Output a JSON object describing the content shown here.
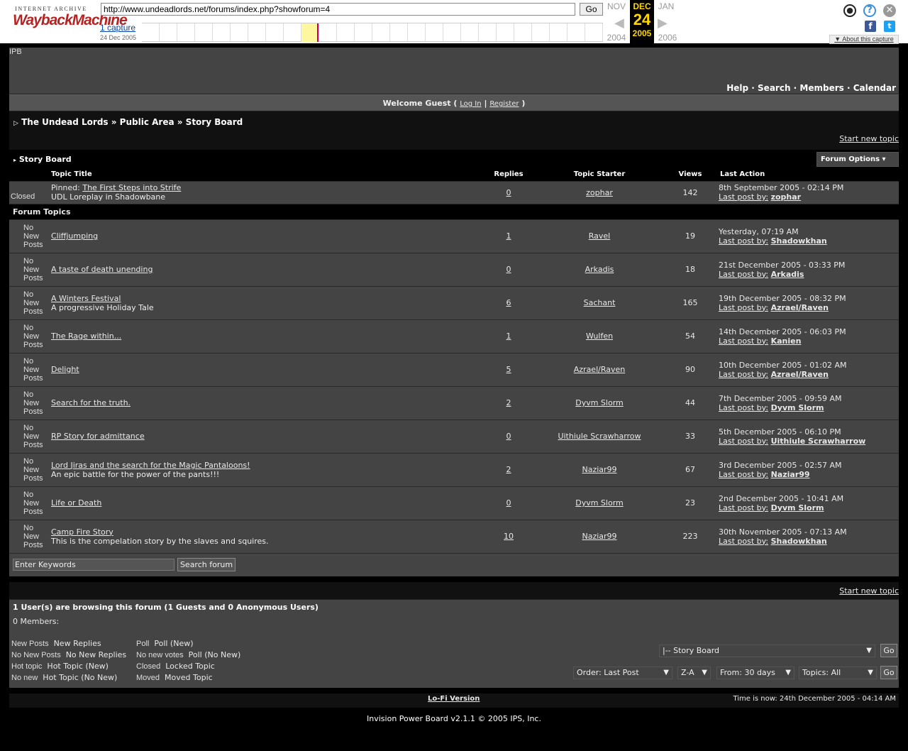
{
  "wayback": {
    "ia_label": "INTERNET ARCHIVE",
    "brand": "WaybackMachine",
    "url": "http://www.undeadlords.net/forums/index.php?showforum=4",
    "go": "Go",
    "captures": "1 capture",
    "capture_date": "24 Dec 2005",
    "prev_month": "NOV",
    "cur_month": "DEC",
    "next_month": "JAN",
    "cur_day": "24",
    "prev_year": "2004",
    "cur_year": "2005",
    "next_year": "2006",
    "about": "About this capture"
  },
  "board": {
    "logo_alt": "IPB",
    "nav": "Help · Search · Members · Calendar",
    "welcome_prefix": "Welcome Guest (",
    "login": "Log In",
    "sep": "|",
    "register": "Register",
    "welcome_suffix": ")",
    "breadcrumb": "The Undead Lords » Public Area » Story Board",
    "start_new": "Start new topic",
    "forum_title": "Story Board",
    "forum_options": "Forum Options",
    "cols": {
      "title": "Topic Title",
      "replies": "Replies",
      "starter": "Topic Starter",
      "views": "Views",
      "last": "Last Action"
    },
    "pinned": {
      "icon": "Closed",
      "prefix": "Pinned:",
      "title": "The First Steps into Strife",
      "desc": "UDL Loreplay in Shadowbane",
      "replies": "0",
      "starter": "zophar",
      "views": "142",
      "date": "8th September 2005 - 02:14 PM",
      "last_by": "zophar"
    },
    "section": "Forum Topics",
    "last_label": "Last post by:",
    "icon_label": "No New Posts",
    "topics": [
      {
        "title": "Cliffjumping",
        "desc": "",
        "replies": "1",
        "starter": "Ravel",
        "views": "19",
        "date": "Yesterday, 07:19 AM",
        "last_by": "Shadowkhan"
      },
      {
        "title": "A taste of death unending",
        "desc": "",
        "replies": "0",
        "starter": "Arkadis",
        "views": "18",
        "date": "21st December 2005 - 03:33 PM",
        "last_by": "Arkadis"
      },
      {
        "title": "A Winters Festival",
        "desc": "A progressive Holiday Tale",
        "replies": "6",
        "starter": "Sachant",
        "views": "165",
        "date": "19th December 2005 - 08:32 PM",
        "last_by": "Azrael/Raven"
      },
      {
        "title": "The Rage within...",
        "desc": "",
        "replies": "1",
        "starter": "Wulfen",
        "views": "54",
        "date": "14th December 2005 - 06:03 PM",
        "last_by": "Kanien"
      },
      {
        "title": "Delight",
        "desc": "",
        "replies": "5",
        "starter": "Azrael/Raven",
        "views": "90",
        "date": "10th December 2005 - 01:02 AM",
        "last_by": "Azrael/Raven"
      },
      {
        "title": "Search for the truth.",
        "desc": "",
        "replies": "2",
        "starter": "Dyvm Slorm",
        "views": "44",
        "date": "7th December 2005 - 09:59 AM",
        "last_by": "Dyvm Slorm"
      },
      {
        "title": "RP Story for admittance",
        "desc": "",
        "replies": "0",
        "starter": "Uithiule Scrawharrow",
        "views": "33",
        "date": "5th December 2005 - 06:10 PM",
        "last_by": "Uithiule Scrawharrow"
      },
      {
        "title": "Lord Jiras and the search for the Magic Pantaloons!",
        "desc": "An epic battle for the power of the pants!!!",
        "replies": "2",
        "starter": "Naziar99",
        "views": "67",
        "date": "3rd December 2005 - 02:57 AM",
        "last_by": "Naziar99"
      },
      {
        "title": "Life or Death",
        "desc": "",
        "replies": "0",
        "starter": "Dyvm Slorm",
        "views": "23",
        "date": "2nd December 2005 - 10:41 AM",
        "last_by": "Dyvm Slorm"
      },
      {
        "title": "Camp Fire Story",
        "desc": "This is the compelation story by the slaves and squires.",
        "replies": "10",
        "starter": "Naziar99",
        "views": "223",
        "date": "30th November 2005 - 07:13 AM",
        "last_by": "Shadowkhan"
      }
    ],
    "search_placeholder": "Enter Keywords",
    "search_btn": "Search forum",
    "browsing": "1 User(s) are browsing this forum (1 Guests and 0 Anonymous Users)",
    "members": "0 Members:",
    "legend": [
      {
        "icon": "New Posts",
        "label": "New Replies"
      },
      {
        "icon": "No New Posts",
        "label": "No New Replies"
      },
      {
        "icon": "Hot topic",
        "label": "Hot Topic (New)"
      },
      {
        "icon": "No new",
        "label": "Hot Topic (No New)"
      },
      {
        "icon": "Poll",
        "label": "Poll (New)"
      },
      {
        "icon": "No new votes",
        "label": "Poll (No New)"
      },
      {
        "icon": "Closed",
        "label": "Locked Topic"
      },
      {
        "icon": "Moved",
        "label": "Moved Topic"
      }
    ],
    "jump": "|-- Story Board",
    "order": "Order: Last Post",
    "sort": "Z-A",
    "from": "From: 30 days",
    "topics_filter": "Topics: All",
    "go": "Go",
    "lofi": "Lo-Fi Version",
    "time": "Time is now: 24th December 2005 - 04:14 AM",
    "copyright": "Invision Power Board v2.1.1 © 2005  IPS, Inc."
  }
}
